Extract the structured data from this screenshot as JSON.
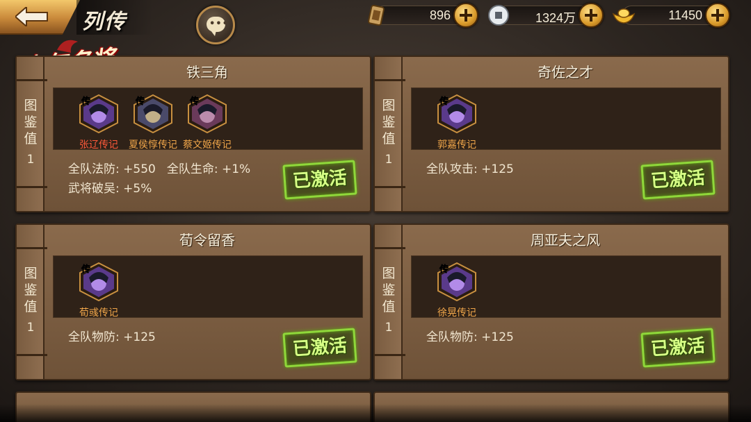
{
  "header": {
    "title": "列传",
    "logo_text": "少年名将"
  },
  "currencies": [
    {
      "icon": "scroll-token-icon",
      "value": "896"
    },
    {
      "icon": "silver-coin-icon",
      "value": "1324万"
    },
    {
      "icon": "gold-ingot-icon",
      "value": "11450"
    }
  ],
  "common": {
    "spine_label": "图鉴值",
    "activated_label": "已激活"
  },
  "cards": [
    {
      "title": "铁三角",
      "score": "1",
      "heroes": [
        {
          "name": "张辽传记",
          "color": "red"
        },
        {
          "name": "夏侯惇传记",
          "color": "orange"
        },
        {
          "name": "蔡文姬传记",
          "color": "orange"
        }
      ],
      "stats": [
        [
          "全队法防: +550",
          "全队生命: +1%"
        ],
        [
          "武将破吴: +5%"
        ]
      ]
    },
    {
      "title": "奇佐之才",
      "score": "1",
      "heroes": [
        {
          "name": "郭嘉传记",
          "color": "orange"
        }
      ],
      "stats": [
        [
          "全队攻击: +125"
        ]
      ]
    },
    {
      "title": "荀令留香",
      "score": "1",
      "heroes": [
        {
          "name": "荀彧传记",
          "color": "orange"
        }
      ],
      "stats": [
        [
          "全队物防: +125"
        ]
      ]
    },
    {
      "title": "周亚夫之风",
      "score": "1",
      "heroes": [
        {
          "name": "徐晃传记",
          "color": "orange"
        }
      ],
      "stats": [
        [
          "全队物防: +125"
        ]
      ]
    }
  ]
}
